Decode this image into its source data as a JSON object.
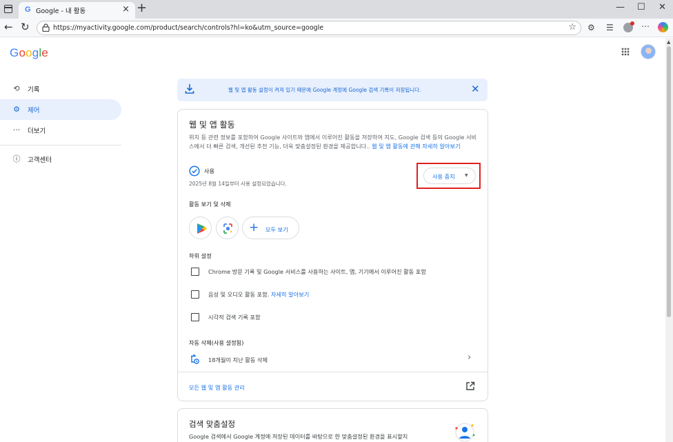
{
  "browser": {
    "tab_favicon": "G",
    "tab_title": "Google - 내 활동",
    "url": "https://myactivity.google.com/product/search/controls?hl=ko&utm_source=google"
  },
  "header": {
    "logo_text": "Google"
  },
  "sidebar": {
    "items": [
      {
        "label": "기록",
        "icon": "history-icon"
      },
      {
        "label": "제어",
        "icon": "gear-icon"
      },
      {
        "label": "더보기",
        "icon": "more-icon"
      },
      {
        "label": "고객센터",
        "icon": "help-icon"
      }
    ]
  },
  "banner": {
    "text": "웹 및 앱 활동 설정이 켜져 있기 때문에 Google 계정에 Google 검색 기록이 저장됩니다."
  },
  "main": {
    "title": "웹 및 앱 활동",
    "desc_text": "위치 등 관련 정보를 포함하여 Google 사이트와 앱에서 이루어진 활동을 저장하여 지도, Google 검색 등의 Google 서비스에서 더 빠른 검색, 개선된 추천 기능, 더욱 맞춤설정된 환경을 제공합니다.. ",
    "desc_link": "웹 및 앱 활동에 관해 자세히 알아보기",
    "status_label": "사용",
    "status_date": "2025년 8월 14일부터 사용 설정되었습니다.",
    "pause_button": "사용 중지",
    "view_delete_heading": "활동 보기 및 삭제",
    "view_all_button": "모두 보기",
    "sub_settings_heading": "하위 설정",
    "checkboxes": [
      {
        "label": "Chrome 방문 기록 및 Google 서비스를 사용하는 사이트, 앱, 기기에서 이루어진 활동 포함",
        "link": ""
      },
      {
        "label": "음성 및 오디오 활동 포함. ",
        "link": "자세히 알아보기"
      },
      {
        "label": "시각적 검색 기록 포함",
        "link": ""
      }
    ],
    "auto_delete_heading": "자동 삭제(사용 설정됨)",
    "auto_delete_label": "18개월이 지난 활동 삭제",
    "manage_link": "모든 웹 및 앱 활동 관리"
  },
  "second_card": {
    "title": "검색 맞춤설정",
    "desc": "Google 검색에서 Google 계정에 저장된 데이터를 바탕으로 한 맞춤설정된 환경을 표시할지"
  },
  "colors": {
    "accent": "#1a73e8",
    "active_bg": "#e8f0fe",
    "highlight_box": "#e02020"
  }
}
